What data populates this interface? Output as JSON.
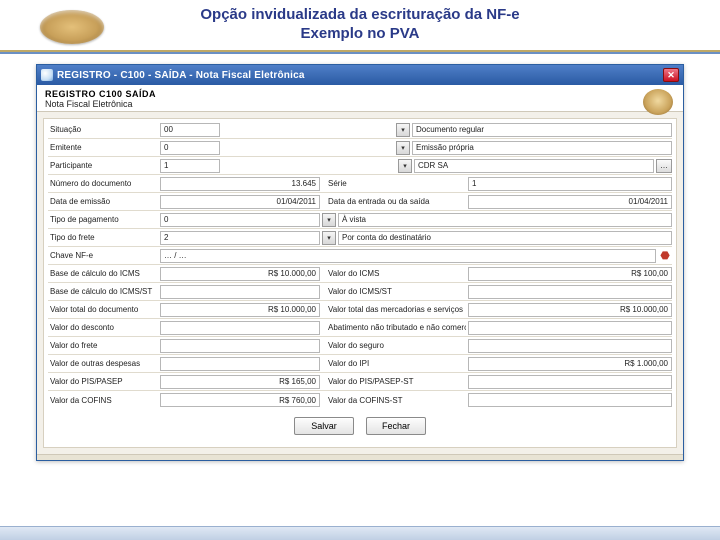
{
  "slide": {
    "title_line1": "Opção invidualizada da escrituração da NF-e",
    "title_line2": "Exemplo no PVA"
  },
  "window": {
    "title": "REGISTRO - C100 - SAÍDA - Nota Fiscal Eletrônica"
  },
  "reg_header": {
    "line1": "REGISTRO  C100  SAÍDA",
    "line2": "Nota Fiscal Eletrônica"
  },
  "fields": {
    "situacao": {
      "label": "Situação",
      "value": "00",
      "desc": "Documento regular"
    },
    "emitente": {
      "label": "Emitente",
      "value": "0",
      "desc": "Emissão própria"
    },
    "participante": {
      "label": "Participante",
      "value": "1",
      "desc": "CDR SA"
    },
    "numero_doc": {
      "label": "Número do documento",
      "value": "13.645",
      "serie_label": "Série",
      "serie_value": "1"
    },
    "data_emissao": {
      "label": "Data de emissão",
      "value": "01/04/2011",
      "data_es_label": "Data da entrada ou da saída",
      "data_es_value": "01/04/2011"
    },
    "tipo_pagamento": {
      "label": "Tipo de pagamento",
      "value": "0",
      "desc": "À vista"
    },
    "tipo_frete": {
      "label": "Tipo do frete",
      "value": "2",
      "desc": "Por conta do destinatário"
    },
    "chave": {
      "label": "Chave NF-e",
      "value": "… / …"
    },
    "bc_icms": {
      "label": "Base de cálculo do ICMS",
      "value": "R$ 10.000,00",
      "r_label": "Valor do ICMS",
      "r_value": "R$ 100,00"
    },
    "bc_icms_st": {
      "label": "Base de cálculo do ICMS/ST",
      "value": "",
      "r_label": "Valor do ICMS/ST",
      "r_value": ""
    },
    "valor_doc": {
      "label": "Valor total do documento",
      "value": "R$ 10.000,00",
      "r_label": "Valor total das mercadorias e serviços",
      "r_value": "R$ 10.000,00"
    },
    "valor_desc": {
      "label": "Valor do desconto",
      "value": "",
      "r_label": "Abatimento não tributado e não comercial",
      "r_value": ""
    },
    "valor_frete": {
      "label": "Valor do frete",
      "value": "",
      "r_label": "Valor do seguro",
      "r_value": ""
    },
    "outras_desp": {
      "label": "Valor de outras despesas",
      "value": "",
      "r_label": "Valor do IPI",
      "r_value": "R$ 1.000,00"
    },
    "pis": {
      "label": "Valor do PIS/PASEP",
      "value": "R$ 165,00",
      "r_label": "Valor do PIS/PASEP-ST",
      "r_value": ""
    },
    "cofins": {
      "label": "Valor da COFINS",
      "value": "R$ 760,00",
      "r_label": "Valor da COFINS-ST",
      "r_value": ""
    }
  },
  "buttons": {
    "salvar": "Salvar",
    "fechar": "Fechar"
  },
  "glyphs": {
    "close": "✕",
    "dropdown": "▾",
    "ellipsis": "…",
    "warn": "⬣"
  }
}
